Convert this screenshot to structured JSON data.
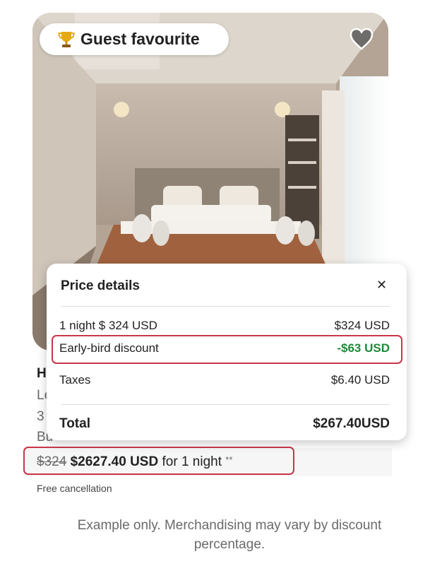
{
  "listing": {
    "badge_label": "Guest favourite",
    "badge_icon": "trophy-icon",
    "favorite_icon": "heart-icon",
    "title_partial": "H",
    "line2_partial": "Le",
    "line3_partial": "3",
    "line4_partial": "Bu",
    "price": {
      "original": "$324",
      "discounted": "$2627.40 USD",
      "suffix": "for 1 night",
      "footnote_mark": "**"
    },
    "cancellation": "Free cancellation"
  },
  "price_details": {
    "title": "Price details",
    "close_icon": "close-icon",
    "lines": [
      {
        "label": "1 night $ 324 USD",
        "amount": "$324 USD"
      },
      {
        "label": "Early-bird discount",
        "amount": "-$63 USD"
      },
      {
        "label": "Taxes",
        "amount": "$6.40 USD"
      }
    ],
    "total": {
      "label": "Total",
      "amount": "$267.40USD"
    }
  },
  "caption": "Example only. Merchandising may vary by discount percentage.",
  "colors": {
    "highlight": "#c8364a",
    "discount": "#1e8a3a",
    "muted_text": "#6a6a6a"
  }
}
